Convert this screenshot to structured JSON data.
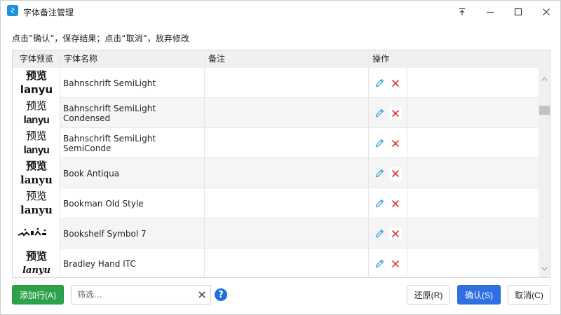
{
  "window": {
    "title": "字体备注管理",
    "icon": "app-logo-icon",
    "controls": [
      "pin-icon",
      "minimize-icon",
      "maximize-icon",
      "close-icon"
    ]
  },
  "hint": "点击“确认”，保存结果；点击“取消”，放弃修改",
  "table": {
    "headers": {
      "preview": "字体预览",
      "name": "字体名称",
      "note": "备注",
      "ops": "操作"
    },
    "preview_text": {
      "top": "预览",
      "bottom": "lanyu"
    },
    "rows": [
      {
        "name": "Bahnschrift SemiLight",
        "note": ""
      },
      {
        "name": "Bahnschrift SemiLight Condensed",
        "note": ""
      },
      {
        "name": "Bahnschrift SemiLight SemiConde",
        "note": ""
      },
      {
        "name": "Book Antiqua",
        "note": ""
      },
      {
        "name": "Bookman Old Style",
        "note": ""
      },
      {
        "name": "Bookshelf Symbol 7",
        "note": ""
      },
      {
        "name": "Bradley Hand ITC",
        "note": ""
      }
    ]
  },
  "footer": {
    "add_label": "添加行(A)",
    "filter_placeholder": "筛选...",
    "filter_value": "",
    "help": "?",
    "reset_label": "还原(R)",
    "ok_label": "确认(S)",
    "cancel_label": "取消(C)"
  },
  "colors": {
    "edit_icon": "#2a9fd6",
    "delete_icon": "#e53935",
    "add_button": "#2ca24a",
    "ok_button": "#2f6fe4",
    "help_icon": "#1f6fe0",
    "app_icon": "#1e8fe1"
  }
}
